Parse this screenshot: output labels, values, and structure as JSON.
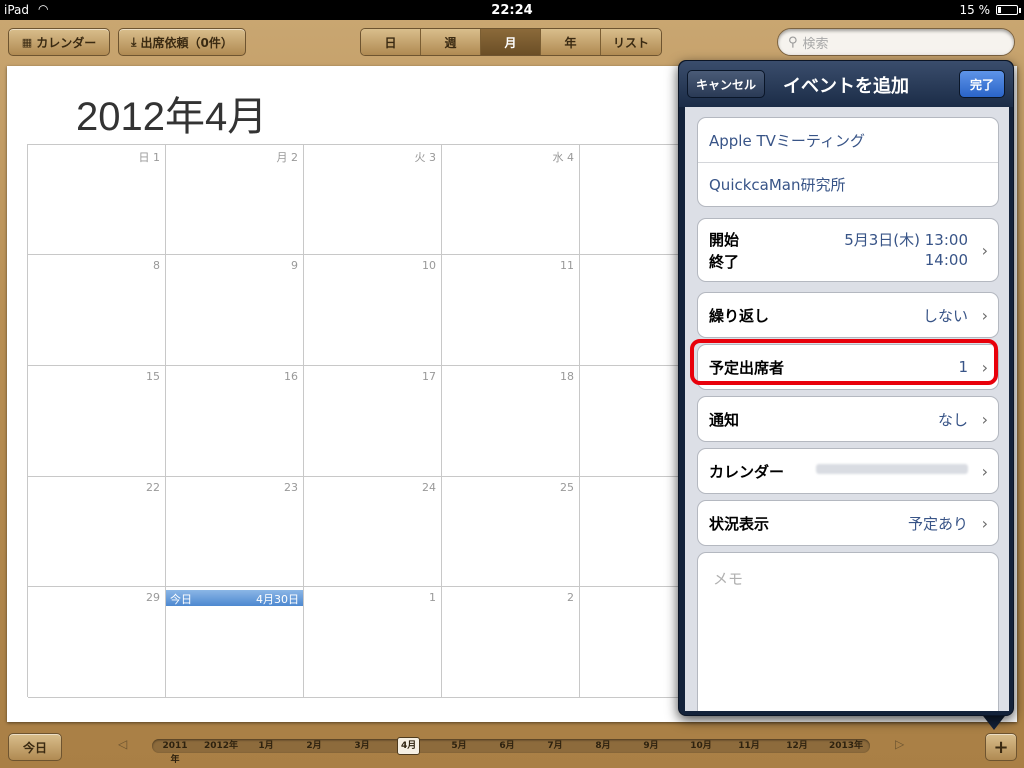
{
  "status": {
    "device": "iPad",
    "time": "22:24",
    "battery": "15 %"
  },
  "toolbar": {
    "calendars_label": "カレンダー",
    "inbox_label": "出席依頼（0件）",
    "views": [
      "日",
      "週",
      "月",
      "年",
      "リスト"
    ],
    "selected_view": "月",
    "search_placeholder": "検索"
  },
  "calendar": {
    "title": "2012年4月",
    "weekdays": [
      "日 1",
      "月 2",
      "火 3",
      "水 4"
    ],
    "weeks": [
      [
        "8",
        "9",
        "10",
        "11"
      ],
      [
        "15",
        "16",
        "17",
        "18"
      ],
      [
        "22",
        "23",
        "24",
        "25"
      ],
      [
        "29",
        "",
        "1",
        "2"
      ]
    ],
    "today_label": "今日",
    "today_date": "4月30日"
  },
  "timeline": {
    "today_button": "今日",
    "items": [
      "2011年",
      "2012年",
      "1月",
      "2月",
      "3月",
      "4月",
      "5月",
      "6月",
      "7月",
      "8月",
      "9月",
      "10月",
      "11月",
      "12月",
      "2013年"
    ],
    "selected": "4月"
  },
  "popover": {
    "title": "イベントを追加",
    "cancel": "キャンセル",
    "done": "完了",
    "event_title": "Apple TVミーティング",
    "location": "QuickcaMan研究所",
    "start_label": "開始",
    "end_label": "終了",
    "start_value": "5月3日(木)  13:00",
    "end_value": "14:00",
    "repeat_label": "繰り返し",
    "repeat_value": "しない",
    "attendees_label": "予定出席者",
    "attendees_value": "1",
    "alert_label": "通知",
    "alert_value": "なし",
    "calendar_label": "カレンダー",
    "availability_label": "状況表示",
    "availability_value": "予定あり",
    "notes_placeholder": "メモ"
  },
  "colors": {
    "highlight": "#e8000b",
    "accent": "#385487",
    "today": "#4d88d0"
  }
}
